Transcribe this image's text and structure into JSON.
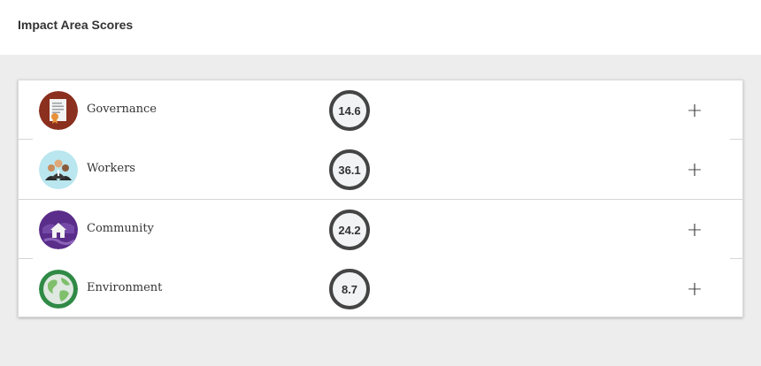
{
  "header": {
    "title": "Impact Area Scores"
  },
  "areas": [
    {
      "label": "Governance",
      "score": "14.6",
      "icon": "certificate-icon",
      "icon_bg": "#8b2f1e"
    },
    {
      "label": "Workers",
      "score": "36.1",
      "icon": "people-group-icon",
      "icon_bg": "#b9e6ef"
    },
    {
      "label": "Community",
      "score": "24.2",
      "icon": "house-community-icon",
      "icon_bg": "#5a2d8a"
    },
    {
      "label": "Environment",
      "score": "8.7",
      "icon": "globe-icon",
      "icon_bg": "#2f8a45"
    }
  ],
  "expand_symbol": "+",
  "colors": {
    "panel_bg": "#ededed",
    "score_ring": "#444444",
    "score_fill": "#f1f3f4"
  }
}
